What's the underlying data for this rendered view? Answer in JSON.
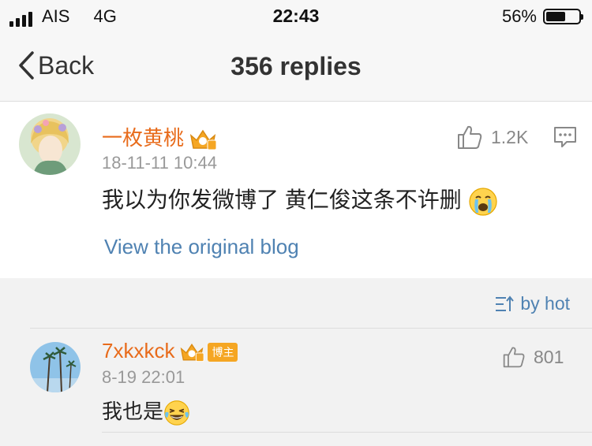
{
  "status_bar": {
    "carrier": "AIS",
    "network": "4G",
    "time": "22:43",
    "battery": "56%",
    "battery_level": 0.56
  },
  "nav": {
    "back_label": "Back",
    "title": "356 replies"
  },
  "main_comment": {
    "username": "一枚黄桃",
    "timestamp": "18-11-11 10:44",
    "text": "我以为你发微博了 黄仁俊这条不许删",
    "likes": "1.2K",
    "view_original": "View the original blog"
  },
  "sort": {
    "label": "by hot"
  },
  "replies": [
    {
      "username": "7xkxkck",
      "badge": "博主",
      "timestamp": "8-19 22:01",
      "text": "我也是",
      "likes": "801"
    }
  ],
  "colors": {
    "username": "#e86b1b",
    "link": "#4f82b2",
    "badge": "#f5a623"
  }
}
